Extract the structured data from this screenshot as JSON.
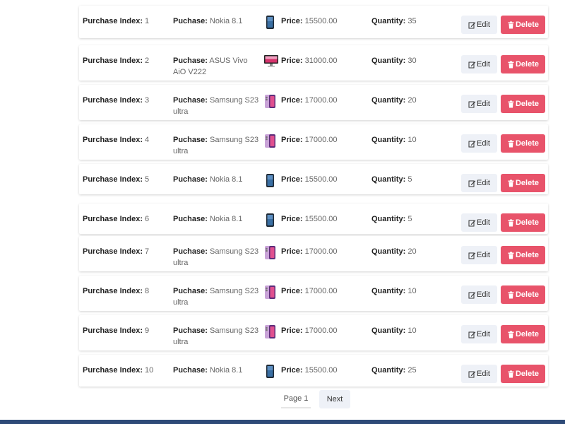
{
  "labels": {
    "index": "Purchase Index:",
    "purchase": "Puchase:",
    "price": "Price:",
    "quantity": "Quantity:",
    "edit": "Edit",
    "delete": "Delete"
  },
  "purchases": [
    {
      "index": "1",
      "name": "Nokia 8.1",
      "price": "15500.00",
      "quantity": "35",
      "image": "phone-dark-icon"
    },
    {
      "index": "2",
      "name": "ASUS Vivo AiO V222",
      "price": "31000.00",
      "quantity": "30",
      "image": "monitor-icon"
    },
    {
      "index": "3",
      "name": "Samsung S23 ultra",
      "price": "17000.00",
      "quantity": "20",
      "image": "phone-pink-icon"
    },
    {
      "index": "4",
      "name": "Samsung S23 ultra",
      "price": "17000.00",
      "quantity": "10",
      "image": "phone-pink-icon"
    },
    {
      "index": "5",
      "name": "Nokia 8.1",
      "price": "15500.00",
      "quantity": "5",
      "image": "phone-dark-icon"
    },
    {
      "index": "6",
      "name": "Nokia 8.1",
      "price": "15500.00",
      "quantity": "5",
      "image": "phone-dark-icon"
    },
    {
      "index": "7",
      "name": "Samsung S23 ultra",
      "price": "17000.00",
      "quantity": "20",
      "image": "phone-pink-icon"
    },
    {
      "index": "8",
      "name": "Samsung S23 ultra",
      "price": "17000.00",
      "quantity": "10",
      "image": "phone-pink-icon"
    },
    {
      "index": "9",
      "name": "Samsung S23 ultra",
      "price": "17000.00",
      "quantity": "10",
      "image": "phone-pink-icon"
    },
    {
      "index": "10",
      "name": "Nokia 8.1",
      "price": "15500.00",
      "quantity": "25",
      "image": "phone-dark-icon"
    }
  ],
  "pagination": {
    "page_label": "Page 1",
    "next_label": "Next"
  },
  "colors": {
    "delete": "#e8536a",
    "edit_bg": "#eef1f7",
    "footer": "#2e4a78"
  }
}
